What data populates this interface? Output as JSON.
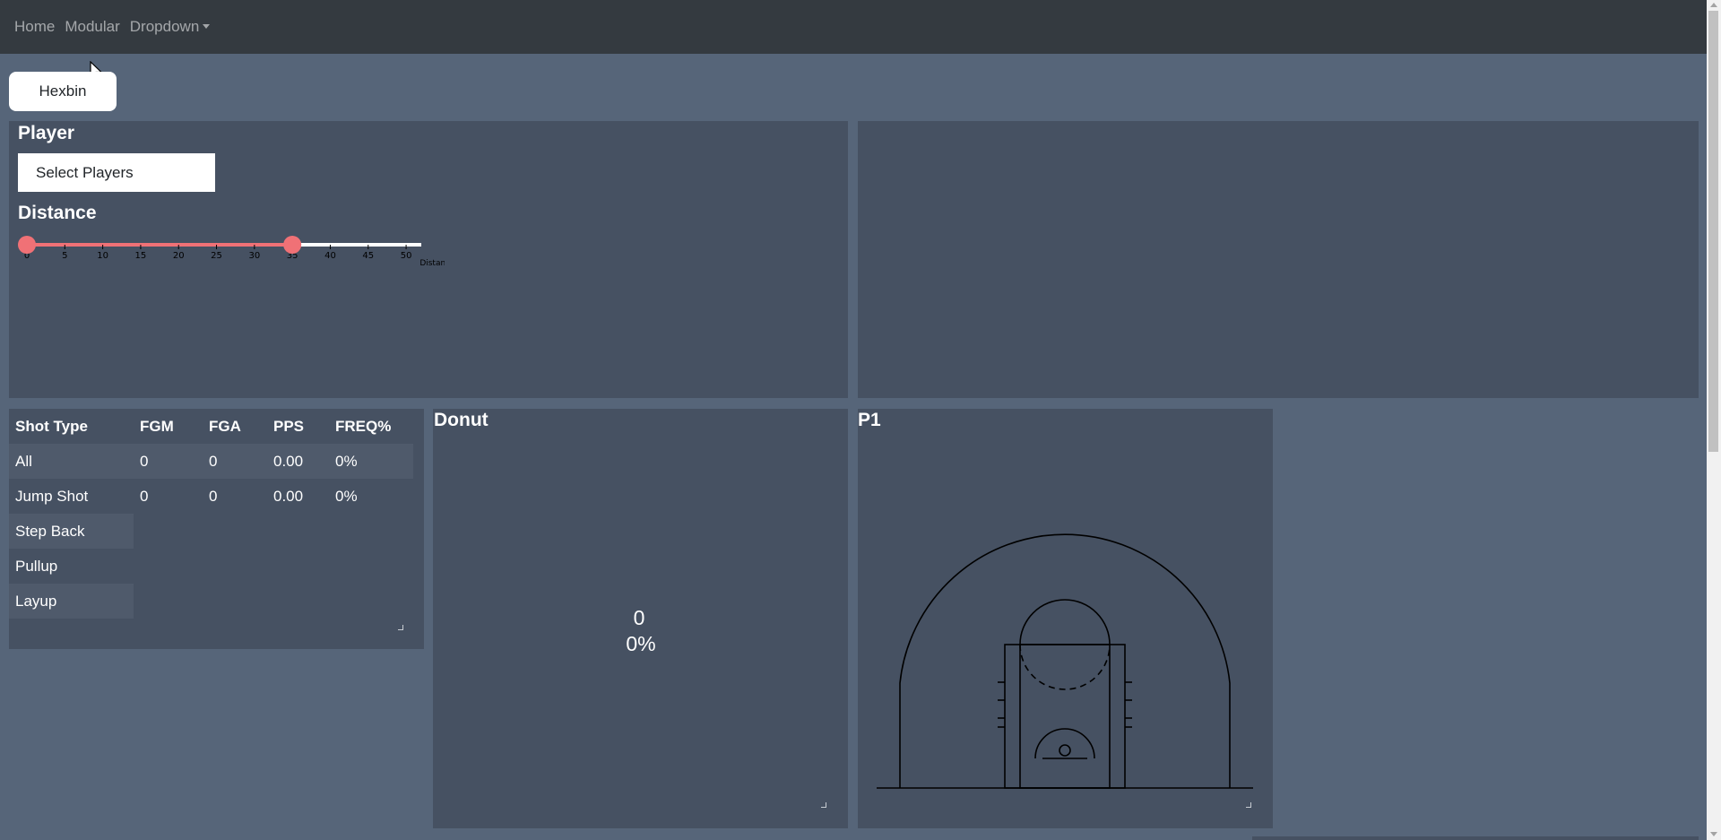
{
  "nav": {
    "home": "Home",
    "modular": "Modular",
    "dropdown": "Dropdown"
  },
  "hexbin_button": "Hexbin",
  "filters": {
    "player_title": "Player",
    "player_select": "Select Players",
    "distance_title": "Distance",
    "slider": {
      "min": 0,
      "max": 52,
      "lower": 0,
      "upper": 35,
      "ticks": [
        "0",
        "5",
        "10",
        "15",
        "20",
        "25",
        "30",
        "35",
        "40",
        "45",
        "50"
      ],
      "axis_label": "Distance",
      "fill_color": "#f07176",
      "handle_color": "#f07176"
    }
  },
  "table": {
    "headers": [
      "Shot Type",
      "FGM",
      "FGA",
      "PPS",
      "FREQ%"
    ],
    "rows": [
      [
        "All",
        "0",
        "0",
        "0.00",
        "0%"
      ],
      [
        "Jump Shot",
        "0",
        "0",
        "0.00",
        "0%"
      ],
      [
        "Step Back"
      ],
      [
        "Pullup"
      ],
      [
        "Layup"
      ]
    ]
  },
  "donut": {
    "title": "Donut",
    "value": "0",
    "percent": "0%"
  },
  "court": {
    "title": "P1"
  },
  "colors": {
    "navbar": "#343a40",
    "page_bg": "#566579",
    "panel_bg": "#465162"
  }
}
